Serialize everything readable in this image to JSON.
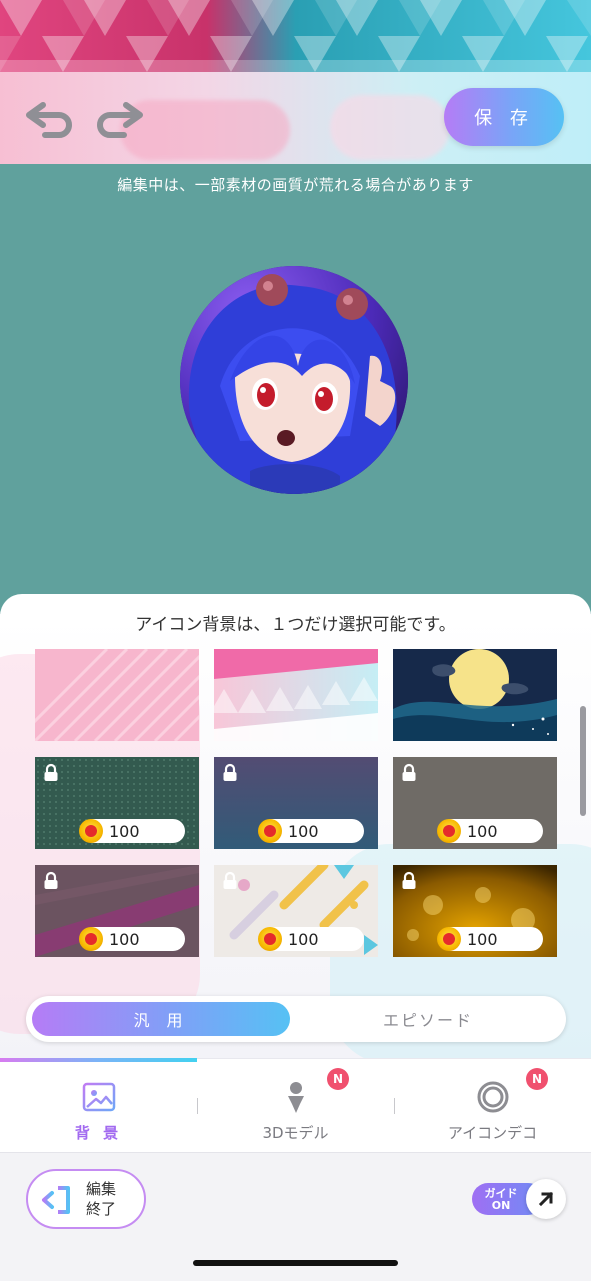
{
  "header": {
    "undo_icon": "undo-arrow-icon",
    "redo_icon": "redo-arrow-icon",
    "save_label": "保 存"
  },
  "preview": {
    "note": "編集中は、一部素材の画質が荒れる場合があります",
    "background_color": "#60a19d"
  },
  "panel": {
    "title": "アイコン背景は、１つだけ選択可能です。",
    "tiles": [
      {
        "name": "pink-stripes",
        "locked": false,
        "price": ""
      },
      {
        "name": "pastel-triangles",
        "locked": false,
        "price": ""
      },
      {
        "name": "full-moon-night",
        "locked": false,
        "price": ""
      },
      {
        "name": "green-dots",
        "locked": true,
        "price": "100"
      },
      {
        "name": "purple-blue-gradient",
        "locked": true,
        "price": "100"
      },
      {
        "name": "gray-plain",
        "locked": true,
        "price": "100"
      },
      {
        "name": "mauve-diagonal",
        "locked": true,
        "price": "100"
      },
      {
        "name": "confetti-shapes",
        "locked": true,
        "price": "100"
      },
      {
        "name": "gold-bokeh",
        "locked": true,
        "price": "100"
      }
    ]
  },
  "segments": {
    "active": "汎 用",
    "other": "エピソード"
  },
  "categories": [
    {
      "label": "背 景",
      "icon": "image-icon",
      "badge": ""
    },
    {
      "label": "3Dモデル",
      "icon": "model-figure-icon",
      "badge": "N"
    },
    {
      "label": "アイコンデコ",
      "icon": "ring-icon",
      "badge": "N"
    }
  ],
  "footer": {
    "end_label": "編集\n終了",
    "guide_label": "ガイド\nON"
  },
  "colors": {
    "accent_start": "#b57cf6",
    "accent_end": "#56c1f4",
    "badge": "#f0506e"
  }
}
